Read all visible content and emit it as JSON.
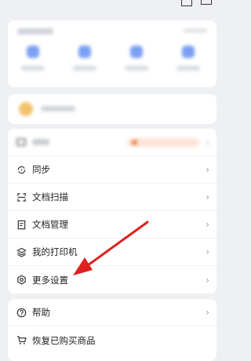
{
  "menu": {
    "items": [
      {
        "label": "同步",
        "icon": "sync-icon"
      },
      {
        "label": "文档扫描",
        "icon": "scan-icon"
      },
      {
        "label": "文档管理",
        "icon": "document-icon"
      },
      {
        "label": "我的打印机",
        "icon": "layers-icon"
      },
      {
        "label": "更多设置",
        "icon": "gear-icon"
      }
    ]
  },
  "help": {
    "items": [
      {
        "label": "帮助",
        "icon": "help-icon"
      },
      {
        "label": "恢复已购买商品",
        "icon": "cart-icon"
      }
    ]
  },
  "chevron": "›",
  "annotation": {
    "color": "#e02020"
  }
}
